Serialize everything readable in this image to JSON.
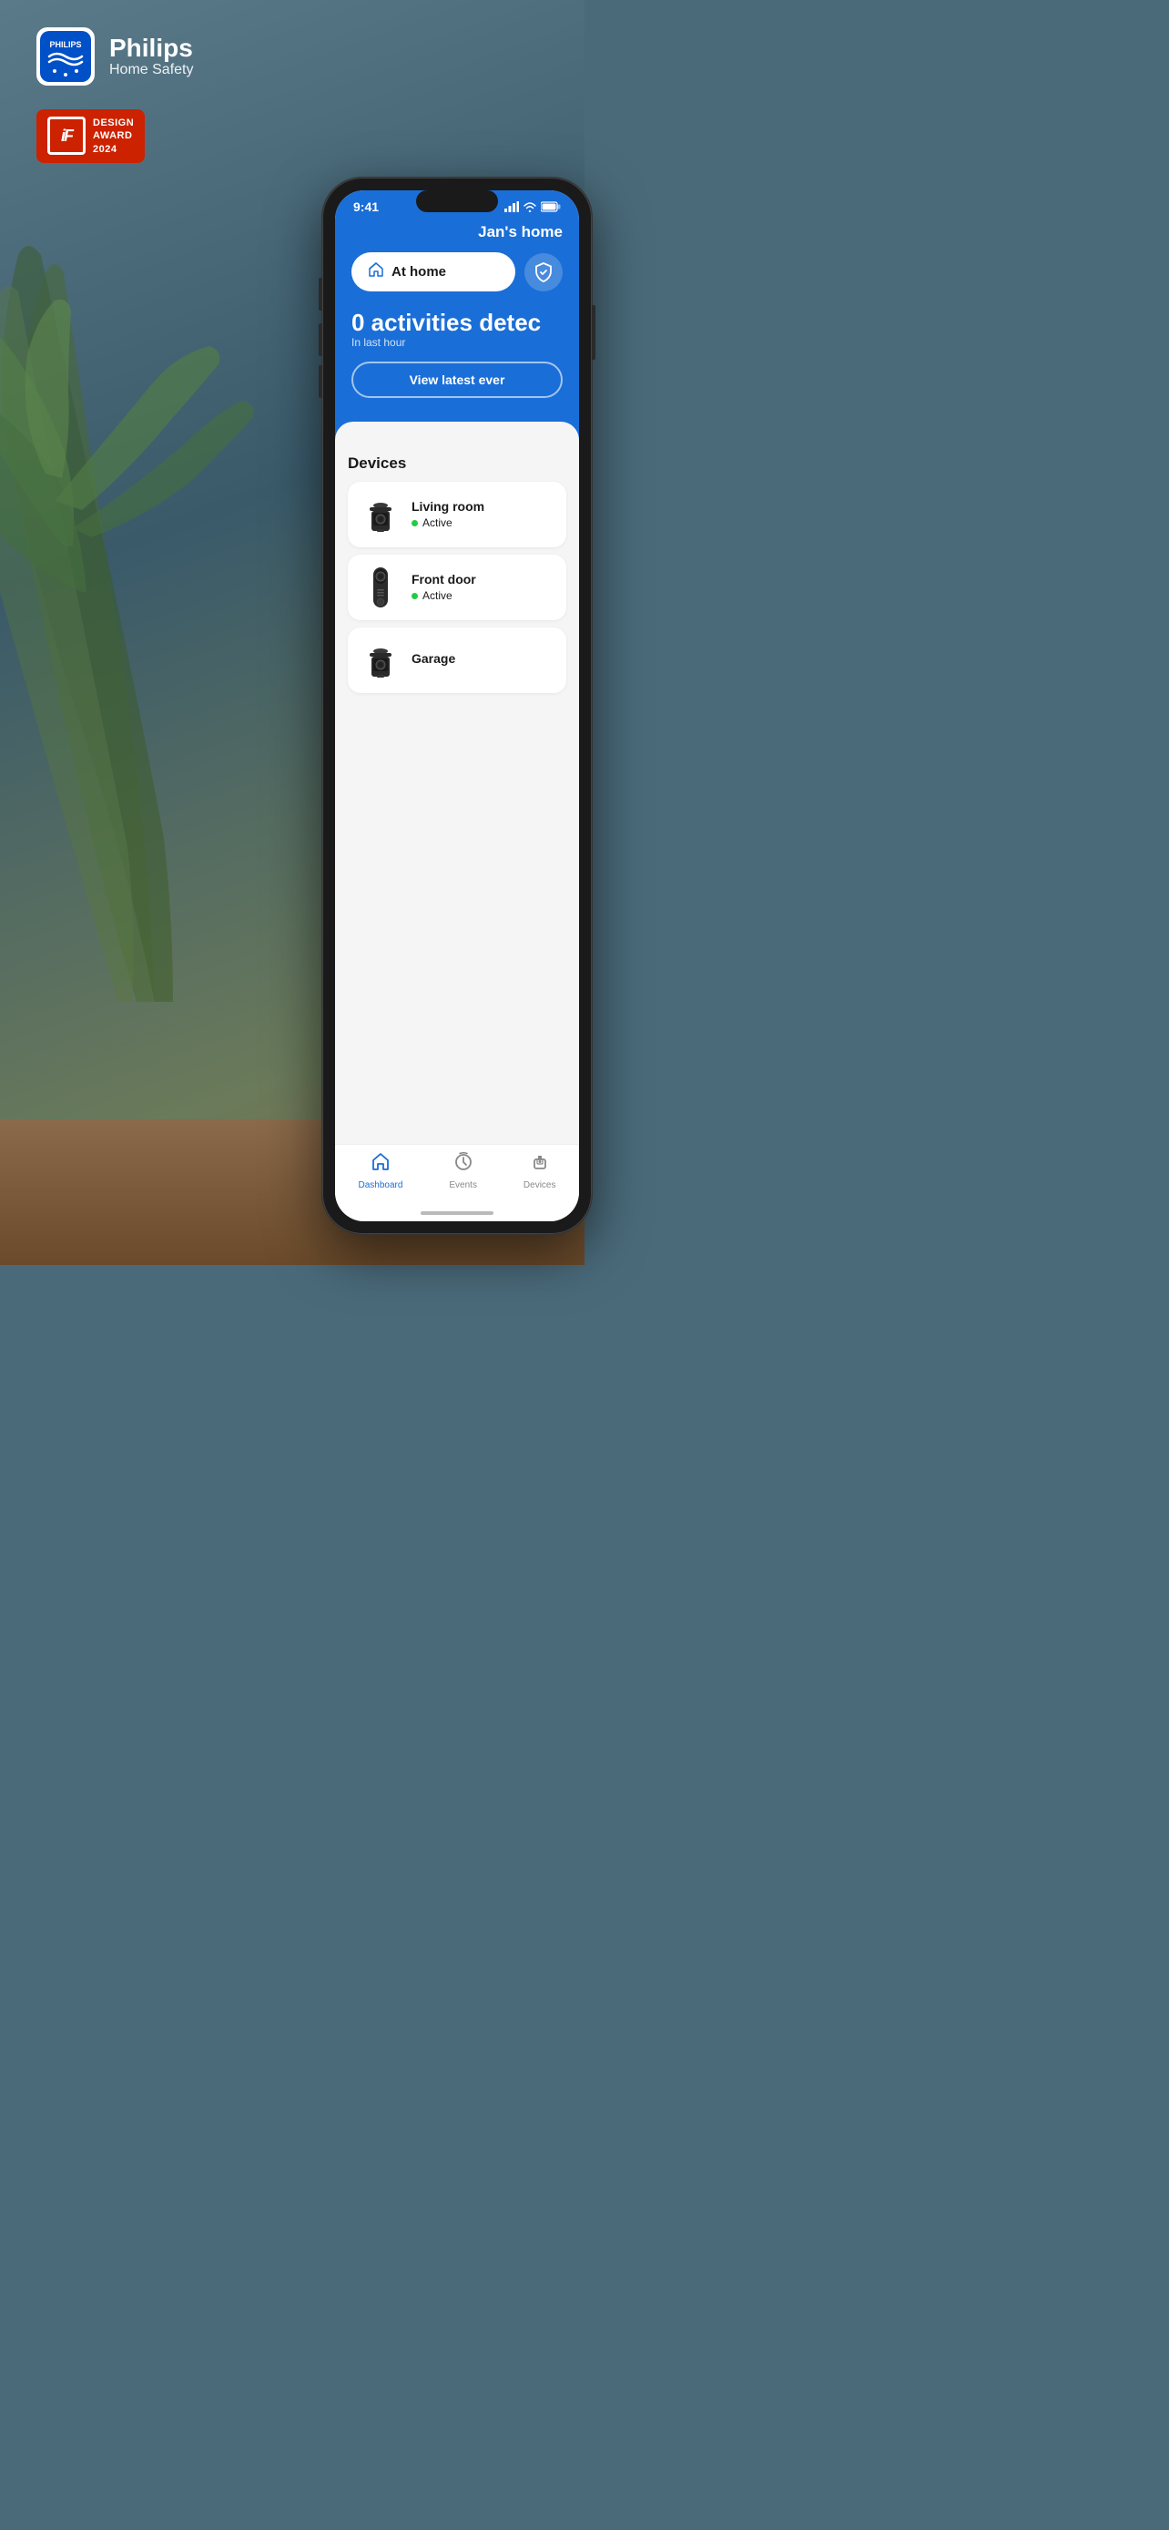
{
  "app": {
    "brand": "Philips",
    "subtitle": "Home Safety"
  },
  "award": {
    "label_if": "iF",
    "label_design": "DESIGN",
    "label_award": "AWARD",
    "label_year": "2024"
  },
  "phone": {
    "status_time": "9:41",
    "home_title": "Jan's home",
    "mode_label": "At home",
    "activity_count": "0 activities detec",
    "activity_sub": "In last hour",
    "view_btn_label": "View latest ever",
    "devices_title": "Devices",
    "devices": [
      {
        "name": "Living room",
        "status": "Active"
      },
      {
        "name": "Front door",
        "status": "Active"
      },
      {
        "name": "Garage",
        "status": ""
      }
    ],
    "nav": [
      {
        "label": "Dashboard",
        "active": true
      },
      {
        "label": "Events",
        "active": false
      },
      {
        "label": "Devices",
        "active": false
      }
    ]
  }
}
